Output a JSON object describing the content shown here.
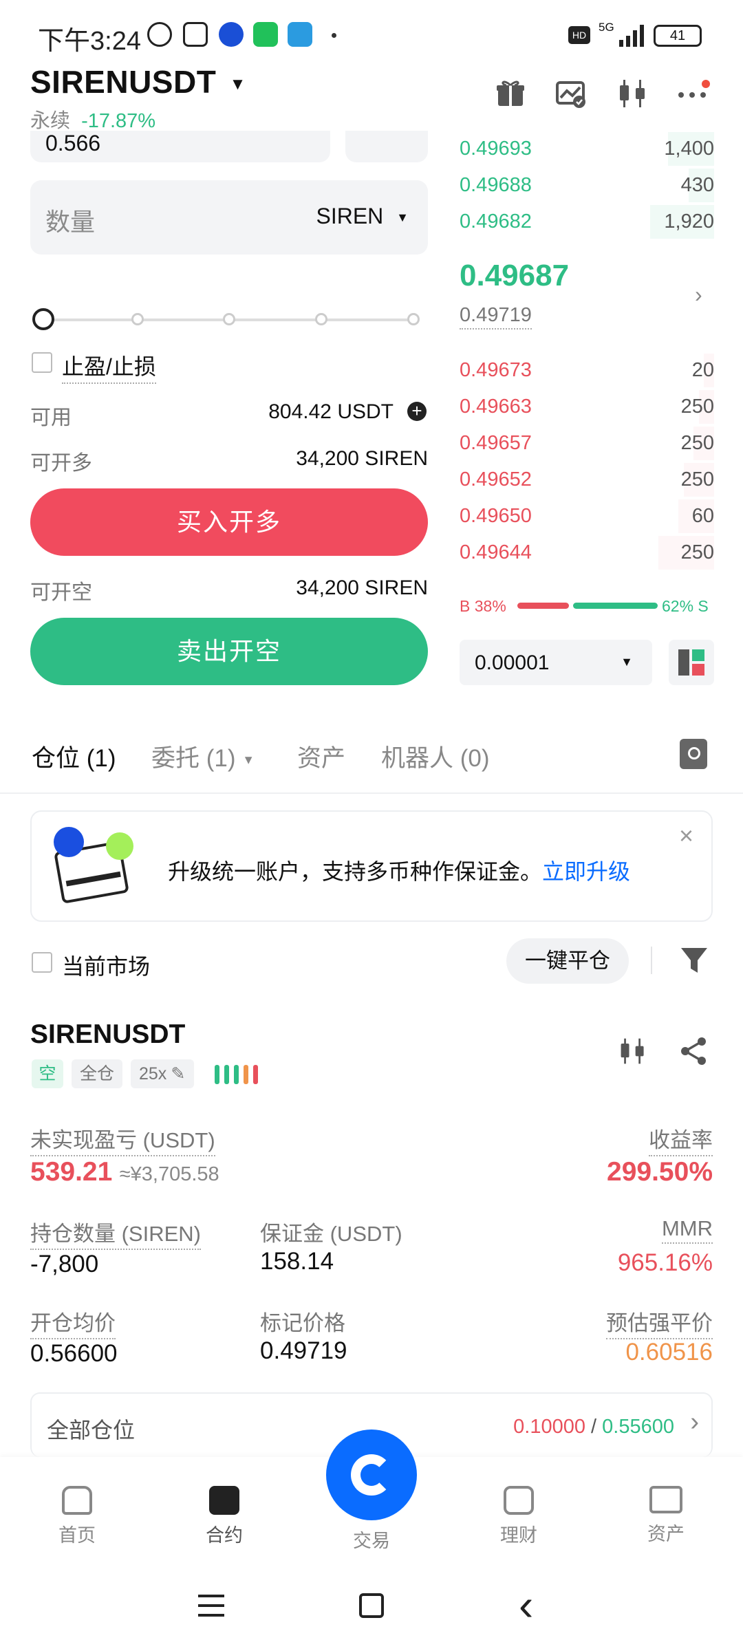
{
  "status_bar": {
    "time": "下午3:24",
    "network": "5G",
    "battery": "41"
  },
  "header": {
    "pair": "SIRENUSDT",
    "market_type": "永续",
    "change": "-17.87%",
    "icons": [
      "gift-icon",
      "chart-settings-icon",
      "candlestick-icon",
      "more-icon"
    ]
  },
  "order_form": {
    "price_value": "0.566",
    "quantity_placeholder": "数量",
    "quantity_unit": "SIREN",
    "slider_percent": 0,
    "tp_sl_label": "止盈/止损",
    "available_label": "可用",
    "available_value": "804.42 USDT",
    "can_long_label": "可开多",
    "can_long_value": "34,200 SIREN",
    "buy_button": "买入开多",
    "can_short_label": "可开空",
    "can_short_value": "34,200 SIREN",
    "sell_button": "卖出开空"
  },
  "order_book": {
    "asks": [
      {
        "price": "0.49693",
        "qty": "1,400",
        "depth": 0.18
      },
      {
        "price": "0.49688",
        "qty": "430",
        "depth": 0.1
      },
      {
        "price": "0.49682",
        "qty": "1,920",
        "depth": 0.25
      }
    ],
    "last_price": "0.49687",
    "mark_price": "0.49719",
    "bids": [
      {
        "price": "0.49673",
        "qty": "20",
        "depth": 0.04
      },
      {
        "price": "0.49663",
        "qty": "250",
        "depth": 0.06
      },
      {
        "price": "0.49657",
        "qty": "250",
        "depth": 0.08
      },
      {
        "price": "0.49652",
        "qty": "250",
        "depth": 0.12
      },
      {
        "price": "0.49650",
        "qty": "60",
        "depth": 0.14
      },
      {
        "price": "0.49644",
        "qty": "250",
        "depth": 0.22
      }
    ],
    "buy_ratio_label": "B 38%",
    "sell_ratio_label": "62% S",
    "buy_ratio": 0.38,
    "precision": "0.00001"
  },
  "tabs": [
    {
      "label": "仓位",
      "count": "(1)",
      "active": true
    },
    {
      "label": "委托",
      "count": "(1)",
      "active": false
    },
    {
      "label": "资产",
      "count": "",
      "active": false
    },
    {
      "label": "机器人",
      "count": "(0)",
      "active": false
    }
  ],
  "banner": {
    "text": "升级统一账户，支持多币种作保证金。",
    "link": "立即升级"
  },
  "filter": {
    "current_market_label": "当前市场",
    "close_all_button": "一键平仓"
  },
  "position": {
    "symbol": "SIRENUSDT",
    "side_tag": "空",
    "margin_mode_tag": "全仓",
    "leverage_tag": "25x",
    "unrealized_pnl_label": "未实现盈亏 (USDT)",
    "unrealized_pnl": "539.21",
    "unrealized_pnl_cny": "≈¥3,705.58",
    "roe_label": "收益率",
    "roe": "299.50%",
    "size_label": "持仓数量 (SIREN)",
    "size": "-7,800",
    "margin_label": "保证金 (USDT)",
    "margin": "158.14",
    "mmr_label": "MMR",
    "mmr": "965.16%",
    "entry_label": "开仓均价",
    "entry": "0.56600",
    "mark_label": "标记价格",
    "mark": "0.49719",
    "liq_label": "预估强平价",
    "liq": "0.60516"
  },
  "all_positions": {
    "label": "全部仓位",
    "red_value": "0.10000",
    "separator": "/",
    "green_value": "0.55600"
  },
  "bottom_nav": [
    {
      "label": "首页",
      "icon": "home-icon"
    },
    {
      "label": "合约",
      "icon": "futures-icon"
    },
    {
      "label": "交易",
      "icon": "trade-icon"
    },
    {
      "label": "理财",
      "icon": "finance-icon"
    },
    {
      "label": "资产",
      "icon": "wallet-icon"
    }
  ],
  "colors": {
    "green": "#2ebd85",
    "red": "#e8505b",
    "blue": "#0a6cff",
    "orange": "#f0944a"
  }
}
